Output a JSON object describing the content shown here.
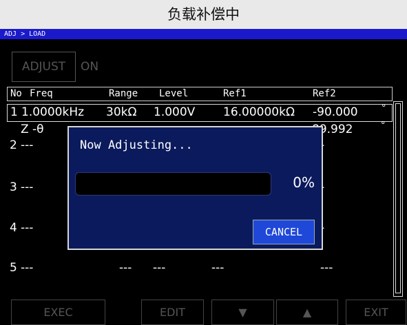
{
  "title": "负载补偿中",
  "breadcrumb": "ADJ > LOAD",
  "adjust_button": "ADJUST",
  "adjust_status": "ON",
  "table": {
    "headers": [
      "No",
      "Freq",
      "Range",
      "Level",
      "Ref1",
      "Ref2"
    ],
    "rows": [
      {
        "no": "1",
        "freq": "1.0000kHz",
        "range": "30kΩ",
        "level": "1.000V",
        "ref1": "16.00000kΩ",
        "ref2": "-90.000",
        "ref2_unit": "°"
      },
      {
        "no": "",
        "freq": "Z -θ",
        "range": "",
        "level": "",
        "ref1": "",
        "ref2": "89.992",
        "ref2_unit": "°"
      },
      {
        "no": "2",
        "freq": "---",
        "range": "",
        "level": "",
        "ref1": "",
        "ref2": "-"
      },
      {
        "no": "3",
        "freq": "---",
        "range": "",
        "level": "",
        "ref1": "",
        "ref2": "-"
      },
      {
        "no": "4",
        "freq": "---",
        "range": "",
        "level": "",
        "ref1": "",
        "ref2": "-"
      },
      {
        "no": "5",
        "freq": "---",
        "range": "---",
        "level": "---",
        "ref1": "---",
        "ref2": "---"
      }
    ]
  },
  "dialog": {
    "message": "Now Adjusting...",
    "progress_percent": 0,
    "progress_label": "0%",
    "cancel": "CANCEL"
  },
  "footer": {
    "exec": "EXEC",
    "edit": "EDIT",
    "down_icon": "▼",
    "up_icon": "▲",
    "exit": "EXIT"
  }
}
